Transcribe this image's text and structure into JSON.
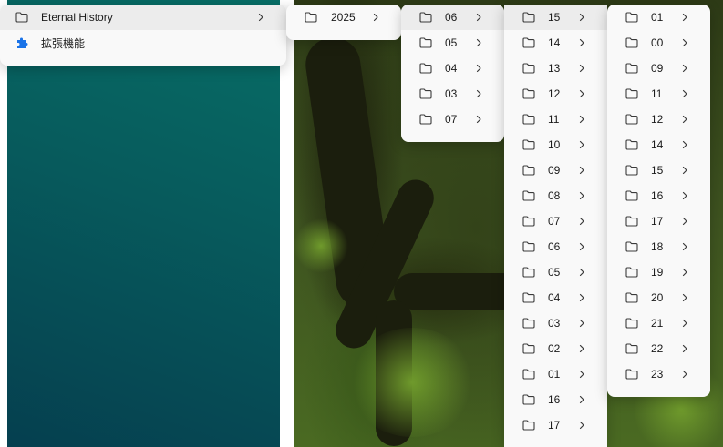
{
  "colors": {
    "menu_background": "#f9f9f9",
    "active_item": "#ececec",
    "extension_icon": "#1a73e8",
    "teal_background": "#076e66"
  },
  "root_menu": {
    "items": [
      {
        "label": "Eternal History",
        "icon": "folder-icon",
        "has_submenu": true,
        "active": true
      },
      {
        "label": "拡張機能",
        "icon": "puzzle-icon",
        "has_submenu": false,
        "active": false
      }
    ]
  },
  "year_menu": {
    "items": [
      {
        "label": "2025",
        "active": false
      }
    ]
  },
  "month_menu": {
    "items": [
      {
        "label": "06",
        "active": true
      },
      {
        "label": "05",
        "active": false
      },
      {
        "label": "04",
        "active": false
      },
      {
        "label": "03",
        "active": false
      },
      {
        "label": "07",
        "active": false
      }
    ]
  },
  "day_menu": {
    "items": [
      {
        "label": "15",
        "active": true
      },
      {
        "label": "14",
        "active": false
      },
      {
        "label": "13",
        "active": false
      },
      {
        "label": "12",
        "active": false
      },
      {
        "label": "11",
        "active": false
      },
      {
        "label": "10",
        "active": false
      },
      {
        "label": "09",
        "active": false
      },
      {
        "label": "08",
        "active": false
      },
      {
        "label": "07",
        "active": false
      },
      {
        "label": "06",
        "active": false
      },
      {
        "label": "05",
        "active": false
      },
      {
        "label": "04",
        "active": false
      },
      {
        "label": "03",
        "active": false
      },
      {
        "label": "02",
        "active": false
      },
      {
        "label": "01",
        "active": false
      },
      {
        "label": "16",
        "active": false
      },
      {
        "label": "17",
        "active": false
      }
    ]
  },
  "hour_menu": {
    "items": [
      {
        "label": "01",
        "active": false
      },
      {
        "label": "00",
        "active": false
      },
      {
        "label": "09",
        "active": false
      },
      {
        "label": "11",
        "active": false
      },
      {
        "label": "12",
        "active": false
      },
      {
        "label": "14",
        "active": false
      },
      {
        "label": "15",
        "active": false
      },
      {
        "label": "16",
        "active": false
      },
      {
        "label": "17",
        "active": false
      },
      {
        "label": "18",
        "active": false
      },
      {
        "label": "19",
        "active": false
      },
      {
        "label": "20",
        "active": false
      },
      {
        "label": "21",
        "active": false
      },
      {
        "label": "22",
        "active": false
      },
      {
        "label": "23",
        "active": false
      }
    ]
  }
}
